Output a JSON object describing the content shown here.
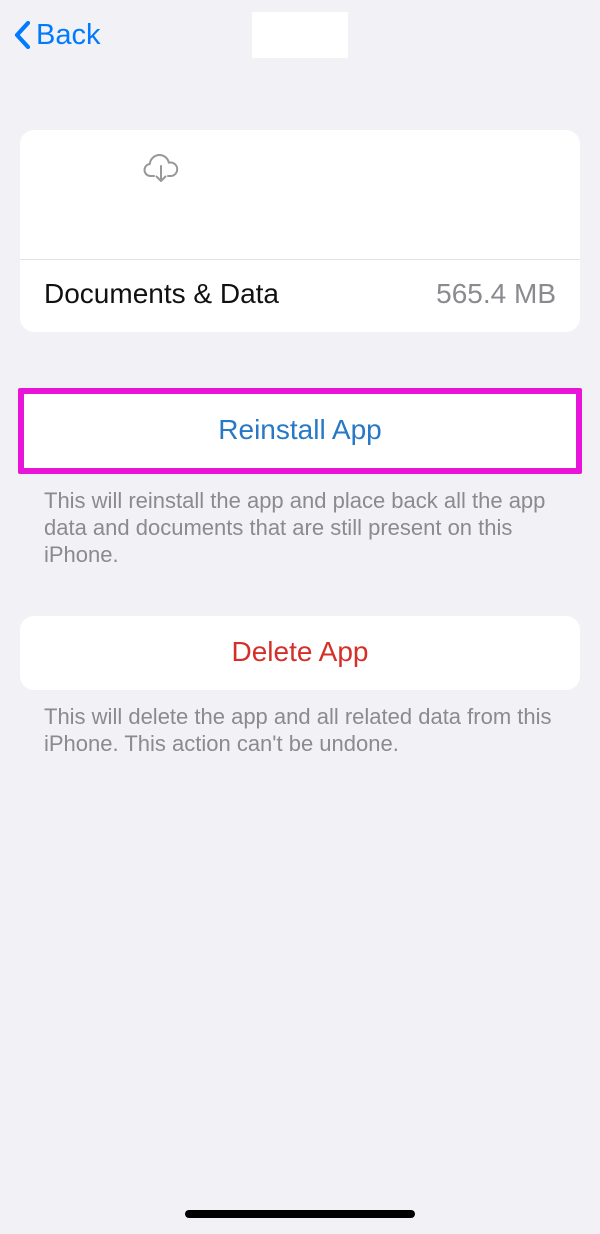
{
  "nav": {
    "back_label": "Back"
  },
  "app_info": {
    "documents_label": "Documents & Data",
    "documents_value": "565.4 MB"
  },
  "reinstall": {
    "button_label": "Reinstall App",
    "description": "This will reinstall the app and place back all the app data and documents that are still present on this iPhone."
  },
  "delete": {
    "button_label": "Delete App",
    "description": "This will delete the app and all related data from this iPhone. This action can't be undone."
  }
}
